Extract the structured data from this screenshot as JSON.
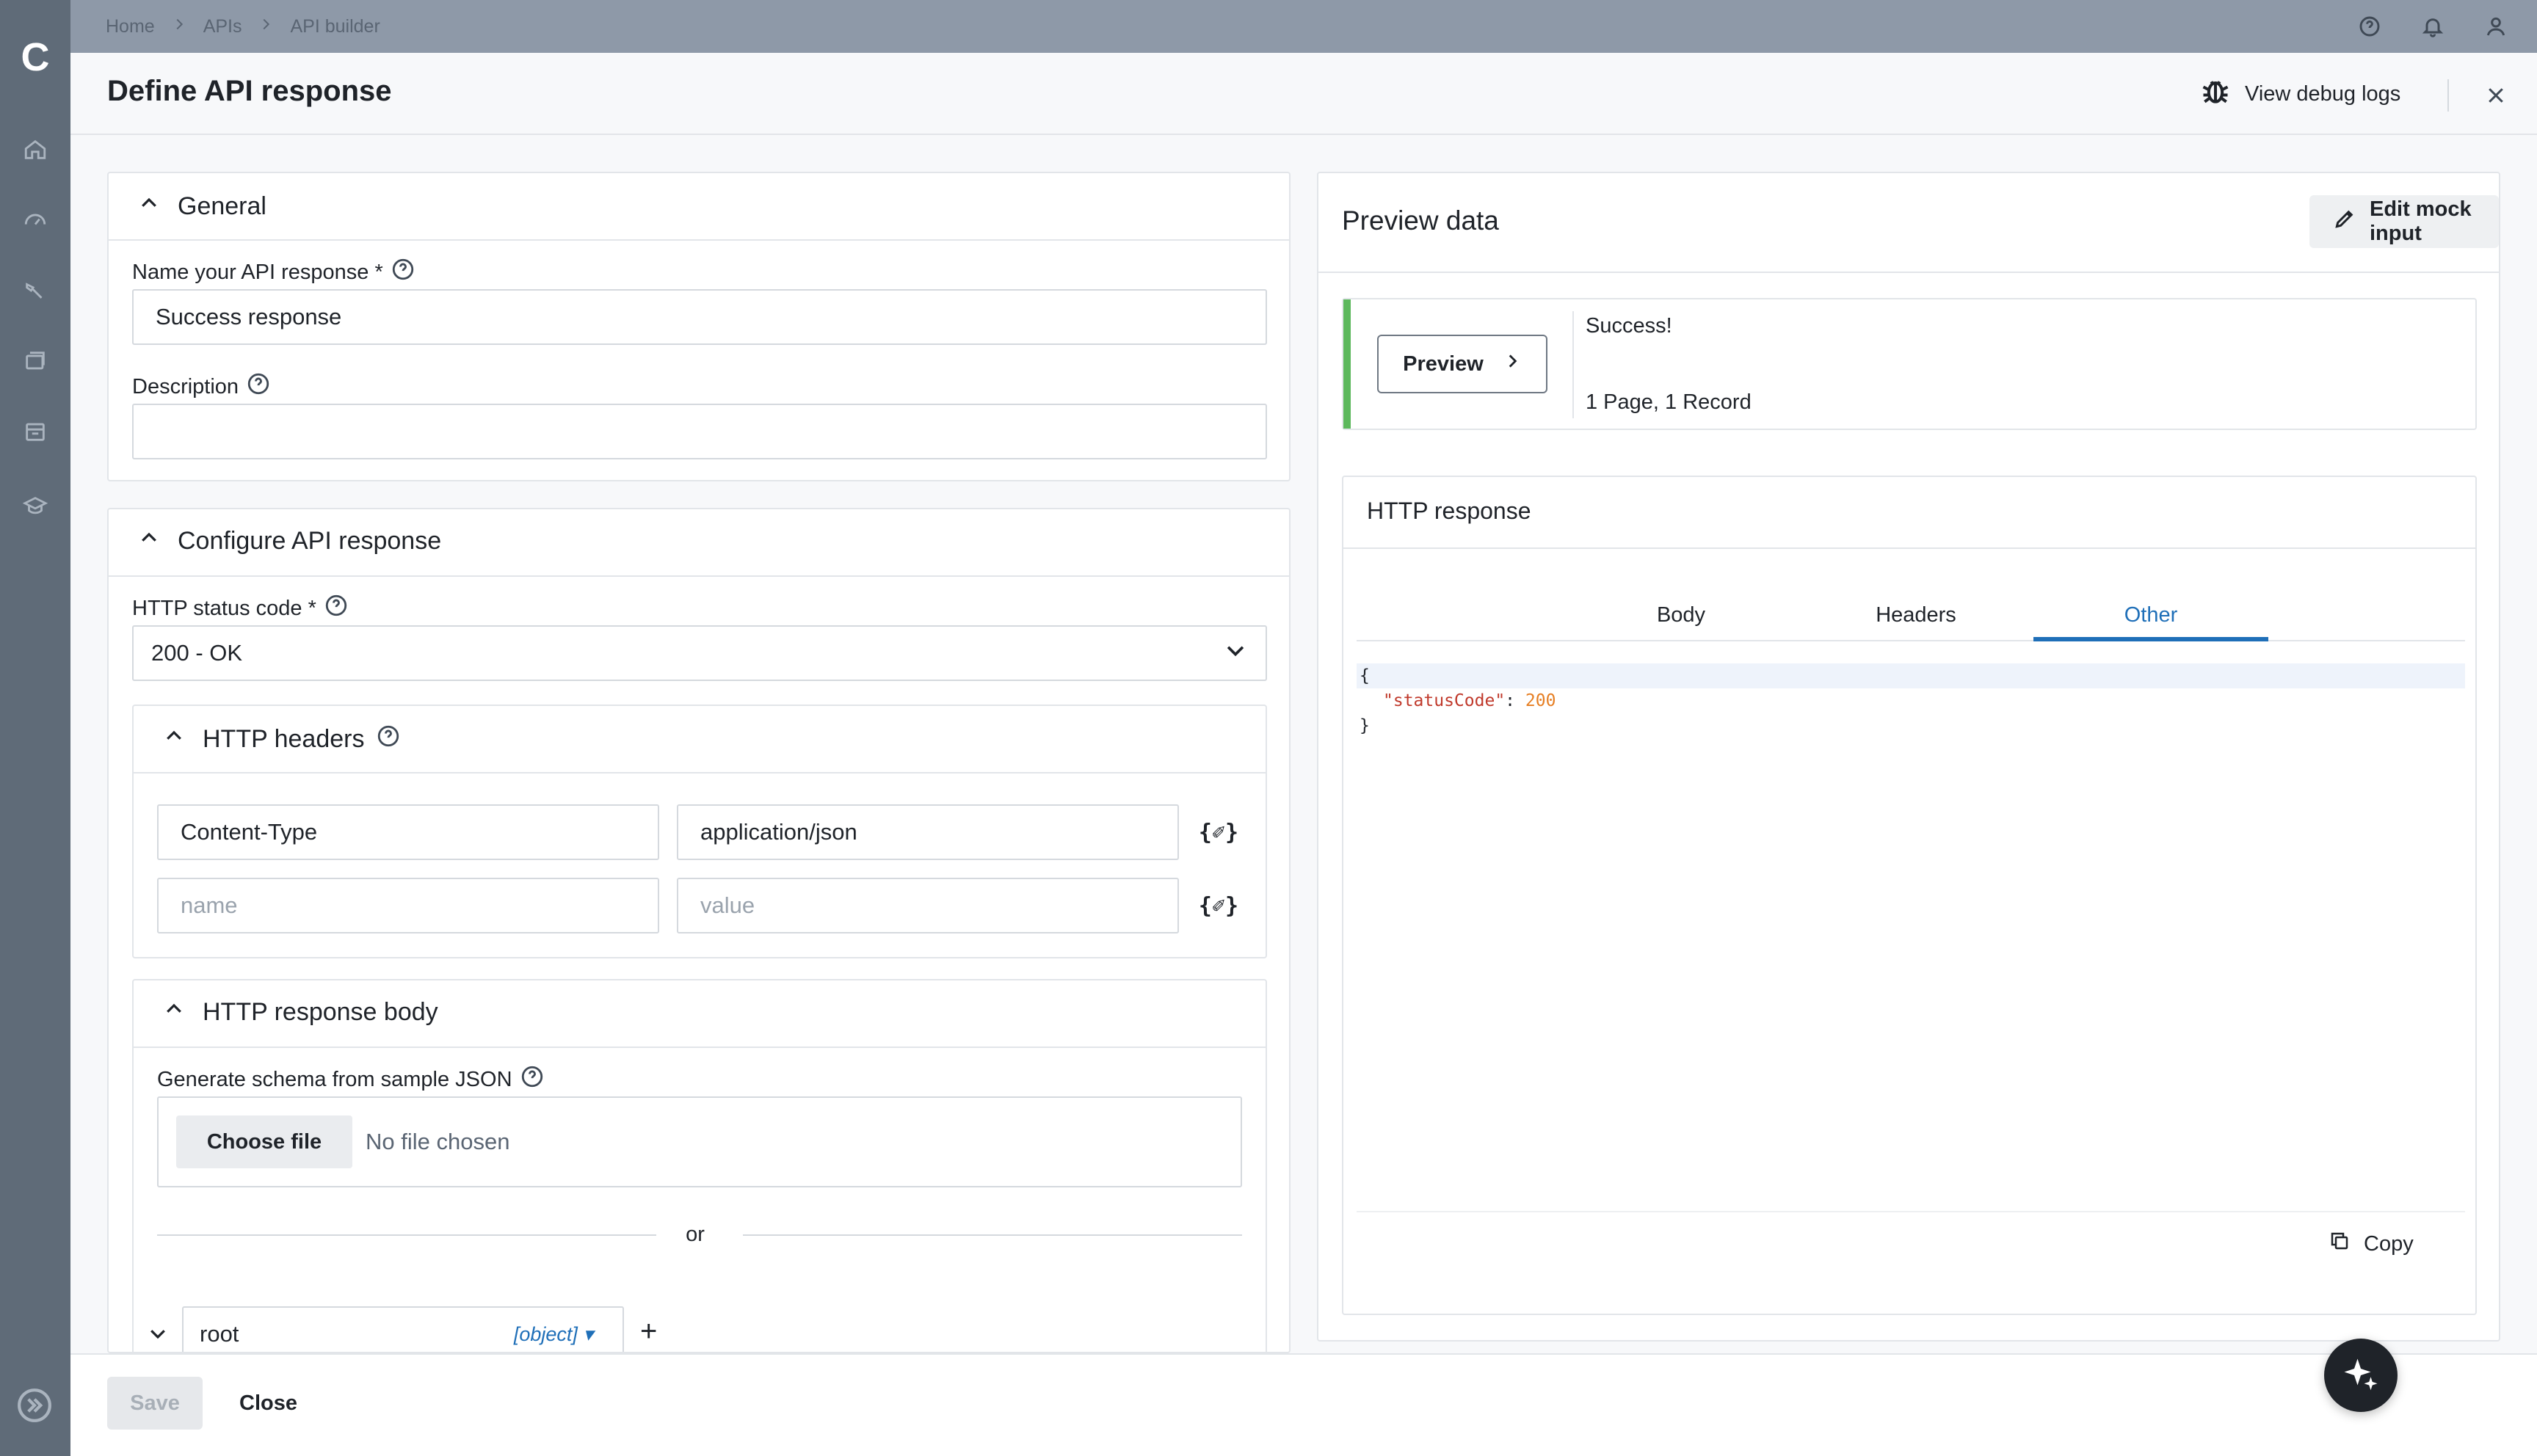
{
  "app": {
    "logo_letter": "C"
  },
  "breadcrumb": [
    "Home",
    "APIs",
    "API builder"
  ],
  "modal": {
    "title": "Define API response",
    "debug_logs_label": "View debug logs"
  },
  "general": {
    "heading": "General",
    "name_label": "Name your API response *",
    "name_value": "Success response",
    "description_label": "Description",
    "description_value": ""
  },
  "configure": {
    "heading": "Configure API response",
    "status_label": "HTTP status code *",
    "status_value": "200 - OK",
    "headers": {
      "heading": "HTTP headers",
      "rows": [
        {
          "name": "Content-Type",
          "value": "application/json"
        }
      ],
      "name_placeholder": "name",
      "value_placeholder": "value",
      "formula_icon": "{✐}"
    },
    "body": {
      "heading": "HTTP response body",
      "schema_label": "Generate schema from sample JSON",
      "choose_file_label": "Choose file",
      "no_file_text": "No file chosen",
      "or_text": "or",
      "schema_root_name": "root",
      "schema_root_type": "[object]",
      "schema_root_menu": "▾",
      "add_symbol": "+"
    }
  },
  "preview": {
    "heading": "Preview data",
    "edit_mock_label": "Edit mock input",
    "preview_button_label": "Preview",
    "result_status": "Success!",
    "result_summary": "1 Page, 1 Record",
    "accent_color": "#5cb85c",
    "http_response": {
      "heading": "HTTP response",
      "tabs": [
        {
          "label": "Body",
          "active": false
        },
        {
          "label": "Headers",
          "active": false
        },
        {
          "label": "Other",
          "active": true
        }
      ],
      "code": {
        "open": "{",
        "key": "\"statusCode\"",
        "colon": ":",
        "value": "200",
        "close": "}"
      },
      "copy_label": "Copy"
    }
  },
  "footer": {
    "save_label": "Save",
    "close_label": "Close"
  }
}
